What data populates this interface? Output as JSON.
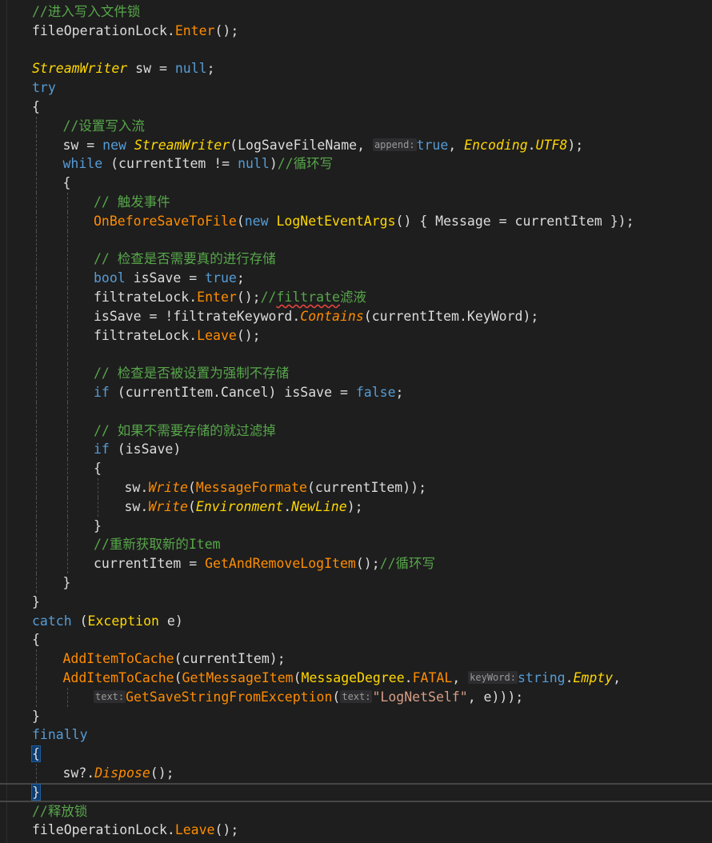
{
  "lines": [
    {
      "indent": 0,
      "tokens": [
        {
          "t": "//进入写入文件锁",
          "c": "c"
        }
      ]
    },
    {
      "indent": 0,
      "tokens": [
        {
          "t": "fileOperationLock."
        },
        {
          "t": "Enter",
          "c": "m"
        },
        {
          "t": "();"
        }
      ]
    },
    {
      "indent": 0,
      "tokens": []
    },
    {
      "indent": 0,
      "tokens": [
        {
          "t": "StreamWriter",
          "c": "t"
        },
        {
          "t": " sw = "
        },
        {
          "t": "null",
          "c": "k"
        },
        {
          "t": ";"
        }
      ]
    },
    {
      "indent": 0,
      "tokens": [
        {
          "t": "try",
          "c": "k"
        }
      ]
    },
    {
      "indent": 0,
      "tokens": [
        {
          "t": "{"
        }
      ]
    },
    {
      "indent": 1,
      "tokens": [
        {
          "t": "//设置写入流",
          "c": "c"
        }
      ]
    },
    {
      "indent": 1,
      "tokens": [
        {
          "t": "sw = "
        },
        {
          "t": "new",
          "c": "k"
        },
        {
          "t": " "
        },
        {
          "t": "StreamWriter",
          "c": "t"
        },
        {
          "t": "(LogSaveFileName, "
        },
        {
          "t": "append:",
          "c": "hint"
        },
        {
          "t": "true",
          "c": "k"
        },
        {
          "t": ", "
        },
        {
          "t": "Encoding",
          "c": "t"
        },
        {
          "t": "."
        },
        {
          "t": "UTF8",
          "c": "t"
        },
        {
          "t": ");"
        }
      ]
    },
    {
      "indent": 1,
      "tokens": [
        {
          "t": "while",
          "c": "k"
        },
        {
          "t": " (currentItem != "
        },
        {
          "t": "null",
          "c": "k"
        },
        {
          "t": ")"
        },
        {
          "t": "//循环写",
          "c": "c"
        }
      ]
    },
    {
      "indent": 1,
      "tokens": [
        {
          "t": "{"
        }
      ]
    },
    {
      "indent": 2,
      "tokens": [
        {
          "t": "// 触发事件",
          "c": "c"
        }
      ]
    },
    {
      "indent": 2,
      "tokens": [
        {
          "t": "OnBeforeSaveToFile",
          "c": "m"
        },
        {
          "t": "("
        },
        {
          "t": "new",
          "c": "k"
        },
        {
          "t": " "
        },
        {
          "t": "LogNetEventArgs",
          "c": "n"
        },
        {
          "t": "() { Message = currentItem });"
        }
      ]
    },
    {
      "indent": 2,
      "tokens": []
    },
    {
      "indent": 2,
      "tokens": [
        {
          "t": "// 检查是否需要真的进行存储",
          "c": "c"
        }
      ]
    },
    {
      "indent": 2,
      "tokens": [
        {
          "t": "bool",
          "c": "k"
        },
        {
          "t": " isSave = "
        },
        {
          "t": "true",
          "c": "k"
        },
        {
          "t": ";"
        }
      ]
    },
    {
      "indent": 2,
      "tokens": [
        {
          "t": "filtrateLock."
        },
        {
          "t": "Enter",
          "c": "m"
        },
        {
          "t": "();"
        },
        {
          "t": "//",
          "c": "c"
        },
        {
          "t": "filtrate",
          "c": "c squig"
        },
        {
          "t": "滤液",
          "c": "c"
        }
      ]
    },
    {
      "indent": 2,
      "tokens": [
        {
          "t": "isSave = !filtrateKeyword."
        },
        {
          "t": "Contains",
          "c": "mi"
        },
        {
          "t": "(currentItem.KeyWord);"
        }
      ]
    },
    {
      "indent": 2,
      "tokens": [
        {
          "t": "filtrateLock."
        },
        {
          "t": "Leave",
          "c": "m"
        },
        {
          "t": "();"
        }
      ]
    },
    {
      "indent": 2,
      "tokens": []
    },
    {
      "indent": 2,
      "tokens": [
        {
          "t": "// 检查是否被设置为强制不存储",
          "c": "c"
        }
      ]
    },
    {
      "indent": 2,
      "tokens": [
        {
          "t": "if",
          "c": "k"
        },
        {
          "t": " (currentItem.Cancel) isSave = "
        },
        {
          "t": "false",
          "c": "k"
        },
        {
          "t": ";"
        }
      ]
    },
    {
      "indent": 2,
      "tokens": []
    },
    {
      "indent": 2,
      "tokens": [
        {
          "t": "// 如果不需要存储的就过滤掉",
          "c": "c"
        }
      ]
    },
    {
      "indent": 2,
      "tokens": [
        {
          "t": "if",
          "c": "k"
        },
        {
          "t": " (isSave)"
        }
      ]
    },
    {
      "indent": 2,
      "tokens": [
        {
          "t": "{"
        }
      ]
    },
    {
      "indent": 3,
      "tokens": [
        {
          "t": "sw."
        },
        {
          "t": "Write",
          "c": "mi"
        },
        {
          "t": "("
        },
        {
          "t": "MessageFormate",
          "c": "m"
        },
        {
          "t": "(currentItem));"
        }
      ]
    },
    {
      "indent": 3,
      "tokens": [
        {
          "t": "sw."
        },
        {
          "t": "Write",
          "c": "mi"
        },
        {
          "t": "("
        },
        {
          "t": "Environment",
          "c": "t"
        },
        {
          "t": "."
        },
        {
          "t": "NewLine",
          "c": "t"
        },
        {
          "t": ");"
        }
      ]
    },
    {
      "indent": 2,
      "tokens": [
        {
          "t": "}"
        }
      ]
    },
    {
      "indent": 2,
      "tokens": [
        {
          "t": "//重新获取新的Item",
          "c": "c"
        }
      ]
    },
    {
      "indent": 2,
      "tokens": [
        {
          "t": "currentItem = "
        },
        {
          "t": "GetAndRemoveLogItem",
          "c": "m"
        },
        {
          "t": "();"
        },
        {
          "t": "//循环写",
          "c": "c"
        }
      ]
    },
    {
      "indent": 1,
      "tokens": [
        {
          "t": "}"
        }
      ]
    },
    {
      "indent": 0,
      "tokens": [
        {
          "t": "}"
        }
      ]
    },
    {
      "indent": 0,
      "tokens": [
        {
          "t": "catch",
          "c": "k"
        },
        {
          "t": " ("
        },
        {
          "t": "Exception",
          "c": "n"
        },
        {
          "t": " e)"
        }
      ]
    },
    {
      "indent": 0,
      "tokens": [
        {
          "t": "{"
        }
      ]
    },
    {
      "indent": 1,
      "tokens": [
        {
          "t": "AddItemToCache",
          "c": "m"
        },
        {
          "t": "(currentItem);"
        }
      ]
    },
    {
      "indent": 1,
      "tokens": [
        {
          "t": "AddItemToCache",
          "c": "m"
        },
        {
          "t": "("
        },
        {
          "t": "GetMessageItem",
          "c": "m"
        },
        {
          "t": "("
        },
        {
          "t": "MessageDegree",
          "c": "n"
        },
        {
          "t": "."
        },
        {
          "t": "FATAL",
          "c": "m"
        },
        {
          "t": ", "
        },
        {
          "t": "keyWord:",
          "c": "hint"
        },
        {
          "t": "string",
          "c": "k"
        },
        {
          "t": "."
        },
        {
          "t": "Empty",
          "c": "t"
        },
        {
          "t": ","
        }
      ]
    },
    {
      "indent": 2,
      "tokens": [
        {
          "t": "text:",
          "c": "hint"
        },
        {
          "t": "GetSaveStringFromException",
          "c": "m"
        },
        {
          "t": "("
        },
        {
          "t": "text:",
          "c": "hint"
        },
        {
          "t": "\"LogNetSelf\"",
          "c": "s"
        },
        {
          "t": ", e)));"
        }
      ]
    },
    {
      "indent": 0,
      "tokens": [
        {
          "t": "}"
        }
      ]
    },
    {
      "indent": 0,
      "tokens": [
        {
          "t": "finally",
          "c": "k"
        }
      ]
    },
    {
      "indent": 0,
      "tokens": [
        {
          "t": "{",
          "c": "brace-hl"
        }
      ]
    },
    {
      "indent": 1,
      "tokens": [
        {
          "t": "sw?."
        },
        {
          "t": "Dispose",
          "c": "mi"
        },
        {
          "t": "();"
        }
      ]
    },
    {
      "indent": 0,
      "current": true,
      "tokens": [
        {
          "t": "}",
          "c": "brace-hl"
        }
      ]
    },
    {
      "indent": 0,
      "tokens": [
        {
          "t": "//释放锁",
          "c": "c"
        }
      ]
    },
    {
      "indent": 0,
      "tokens": [
        {
          "t": "fileOperationLock."
        },
        {
          "t": "Leave",
          "c": "m"
        },
        {
          "t": "();"
        }
      ]
    }
  ]
}
